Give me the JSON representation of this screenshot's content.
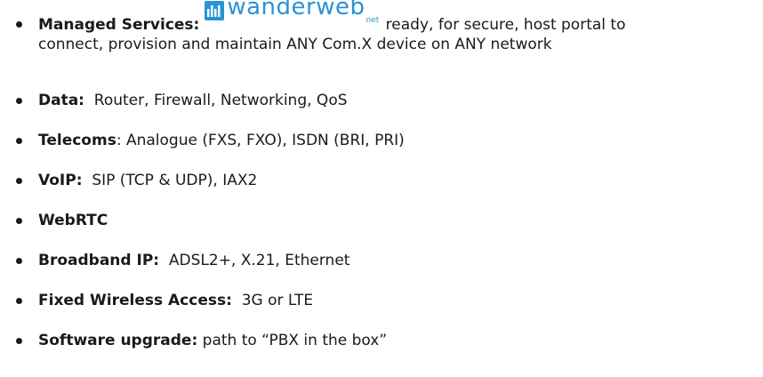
{
  "items": [
    {
      "label": "Managed Services:",
      "logo_text": "wanderweb",
      "logo_suffix": "net",
      "detail_line1": " ready, for secure, host portal to",
      "detail_line2": "connect, provision and maintain ANY Com.X device on ANY network"
    },
    {
      "label": "Data:",
      "detail": "Router, Firewall, Networking, QoS"
    },
    {
      "label": "Telecoms",
      "detail": ":  Analogue (FXS, FXO), ISDN (BRI, PRI)"
    },
    {
      "label": "VoIP:",
      "detail": "SIP (TCP & UDP), IAX2"
    },
    {
      "label": "WebRTC",
      "detail": ""
    },
    {
      "label": "Broadband IP:",
      "detail": "ADSL2+, X.21, Ethernet"
    },
    {
      "label": "Fixed Wireless Access:",
      "detail": "3G or LTE"
    },
    {
      "label": "Software upgrade:",
      "detail": "path to “PBX in the box”"
    }
  ],
  "colors": {
    "text": "#1a1a1a",
    "logo": "#2a93d5"
  },
  "icons": {
    "logo_mark": "wanderweb-logo-icon",
    "bullet": "bullet-dot"
  }
}
